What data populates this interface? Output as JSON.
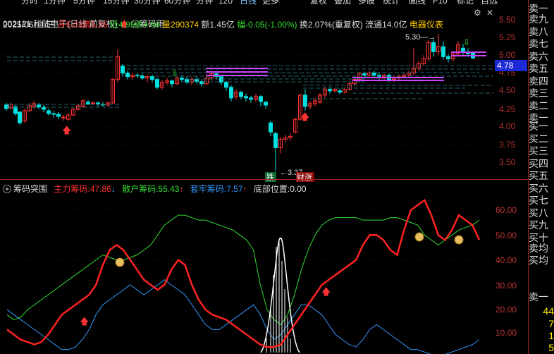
{
  "tabs": [
    "分时",
    "1分钟",
    "5分钟",
    "15分钟",
    "30分钟",
    "60分钟",
    "分钟",
    "120",
    "日线",
    "更多",
    "复权",
    "叠加",
    "多股",
    "统计",
    "画线",
    "F10",
    "标记",
    "自选"
  ],
  "tabs_active": "日线",
  "stock": {
    "code": "002121",
    "name": "科陆电子(日线 前复权)",
    "indicator": "筹码雨",
    "date": "2025/06/11/三",
    "open_label": "开",
    "open": "5.03",
    "high_label": "高",
    "high": "5.05",
    "low_label": "低",
    "low": "4.95",
    "close_label": "收",
    "close": "4.96",
    "vol_label": "量",
    "vol": "290374",
    "amount": "额1.45亿",
    "change_label": "幅",
    "change": "-0.05(-1.00%)",
    "turnover": "换2.07%(重复权)",
    "float_cap": "流通14.0亿",
    "sector": "电器仪表"
  },
  "price_axis": [
    "5.50",
    "5.25",
    "5.00",
    "4.75",
    "4.50",
    "4.25",
    "4.00",
    "3.75",
    "3.50"
  ],
  "current_price": "4.78",
  "annotations": {
    "high_mark": "5.30",
    "low_mark": "3.37",
    "die": "跌",
    "caizhang": "财涨"
  },
  "lower": {
    "title": "筹码突围",
    "main_label": "主力筹码:",
    "main_value": "47.86",
    "main_arrow": "↓",
    "retail_label": "散户筹码:",
    "retail_value": "55.43",
    "retail_arrow": "↑",
    "trap_label": "套牢筹码:",
    "trap_value": "7.57",
    "trap_arrow": "↑",
    "bottom_label": "底部位置:",
    "bottom_value": "0.00",
    "axis": [
      "60.00",
      "50.00",
      "40.00",
      "30.00",
      "20.00",
      "10.00"
    ]
  },
  "side": {
    "sell": [
      "卖九",
      "卖八",
      "卖七",
      "卖六",
      "卖五",
      "卖四",
      "卖三",
      "卖二",
      "卖一"
    ],
    "buy": [
      "买一",
      "买二",
      "买三",
      "买四",
      "买五",
      "买六",
      "买七",
      "买八",
      "买九",
      "买十"
    ],
    "buy_avg": "买均",
    "sell_avg": "卖均",
    "buy_avg2": "买均",
    "bottom_label": "卖一",
    "bottom_nums": [
      "44",
      "7",
      "1",
      "5"
    ]
  },
  "colors": {
    "up": "#ff3333",
    "down": "#00e0e0",
    "main": "#ff2222",
    "retail": "#33dd33",
    "trap": "#3399ff",
    "chip": "#cc44ff",
    "axis": "#bb3333"
  }
}
